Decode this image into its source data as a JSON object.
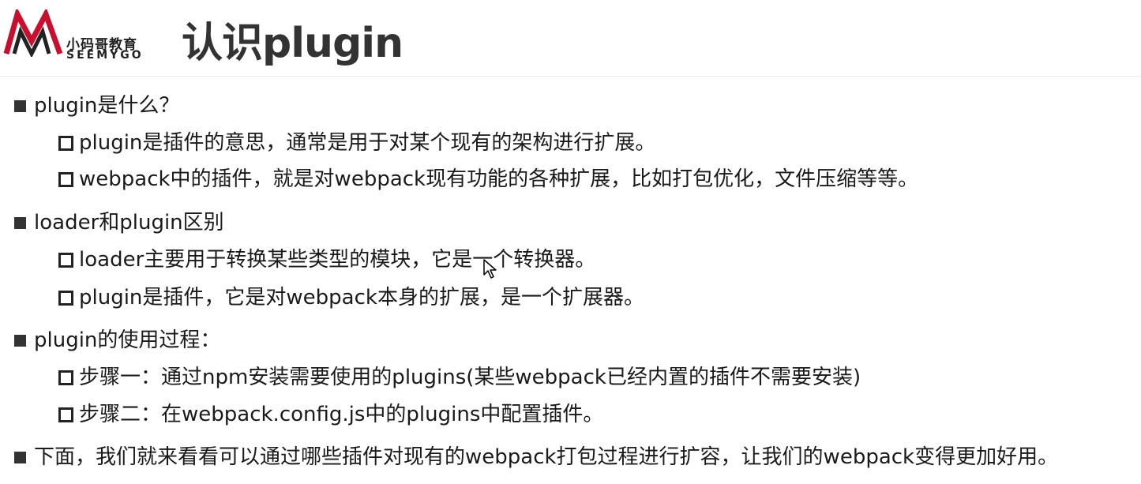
{
  "header": {
    "logo_cn": "小码哥教育",
    "logo_en": "SEEMYGO",
    "title": "认识plugin"
  },
  "sections": [
    {
      "heading": "plugin是什么？",
      "items": [
        "plugin是插件的意思，通常是用于对某个现有的架构进行扩展。",
        "webpack中的插件，就是对webpack现有功能的各种扩展，比如打包优化，文件压缩等等。"
      ]
    },
    {
      "heading": "loader和plugin区别",
      "items": [
        "loader主要用于转换某些类型的模块，它是一个转换器。",
        "plugin是插件，它是对webpack本身的扩展，是一个扩展器。"
      ]
    },
    {
      "heading": "plugin的使用过程：",
      "items": [
        "步骤一：通过npm安装需要使用的plugins(某些webpack已经内置的插件不需要安装)",
        "步骤二：在webpack.config.js中的plugins中配置插件。"
      ]
    },
    {
      "heading": "下面，我们就来看看可以通过哪些插件对现有的webpack打包过程进行扩容，让我们的webpack变得更加好用。",
      "items": []
    }
  ],
  "colors": {
    "logo_red": "#c8102e",
    "text": "#1a1a1a"
  },
  "icons": {
    "level1_bullet": "filled-square",
    "level2_bullet": "hollow-square",
    "cursor": "mouse-pointer"
  }
}
